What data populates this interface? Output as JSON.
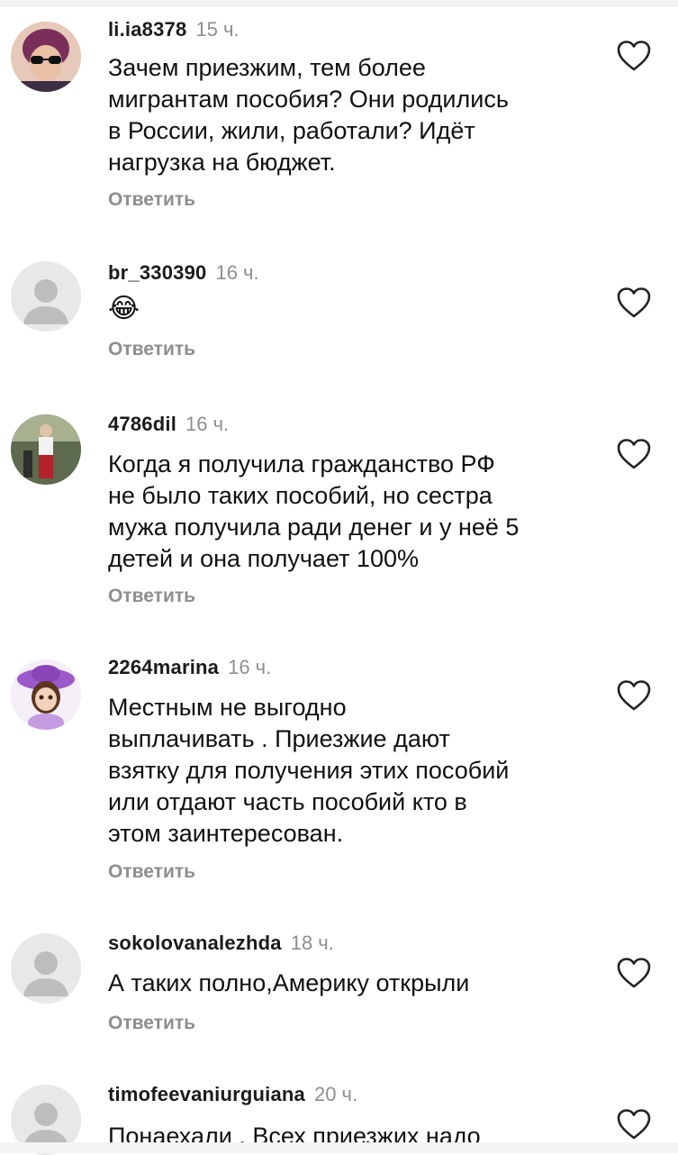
{
  "comments": [
    {
      "username": "li.ia8378",
      "time": "15 ч.",
      "lines": [
        "Зачем приезжим, тем более",
        "мигрантам пособия? Они родились",
        "в России, жили, работали? Идёт",
        "нагрузка на бюджет."
      ],
      "reply": "Ответить",
      "avatar": "photo-avatar"
    },
    {
      "username": "br_330390",
      "time": "16 ч.",
      "lines": [
        "😂"
      ],
      "reply": "Ответить",
      "avatar": "default-avatar"
    },
    {
      "username": "4786dil",
      "time": "16 ч.",
      "lines": [
        "Когда я получила гражданство РФ",
        "не было таких пособий, но сестра",
        "мужа получила ради денег и у неё 5",
        "детей и она получает 100%"
      ],
      "reply": "Ответить",
      "avatar": "photo-avatar"
    },
    {
      "username": "2264marina",
      "time": "16 ч.",
      "lines": [
        "Местным не выгодно",
        "выплачивать . Приезжие дают",
        "взятку для получения этих пособий",
        "или отдают часть пособий кто в",
        "этом заинтересован."
      ],
      "reply": "Ответить",
      "avatar": "cartoon-avatar"
    },
    {
      "username": "sokolovanalezhda",
      "time": "18 ч.",
      "lines": [
        "А таких полно,Америку открыли"
      ],
      "reply": "Ответить",
      "avatar": "default-avatar"
    },
    {
      "username": "timofeevaniurguiana",
      "time": "20 ч.",
      "lines": [
        "Понаехали . Всех приезжих надо"
      ],
      "reply": "",
      "avatar": "default-avatar"
    }
  ],
  "icons": {
    "like": "heart-outline-icon",
    "default_avatar": "person-silhouette-icon"
  },
  "colors": {
    "meta_gray": "#8e8e8e",
    "text": "#111111"
  }
}
